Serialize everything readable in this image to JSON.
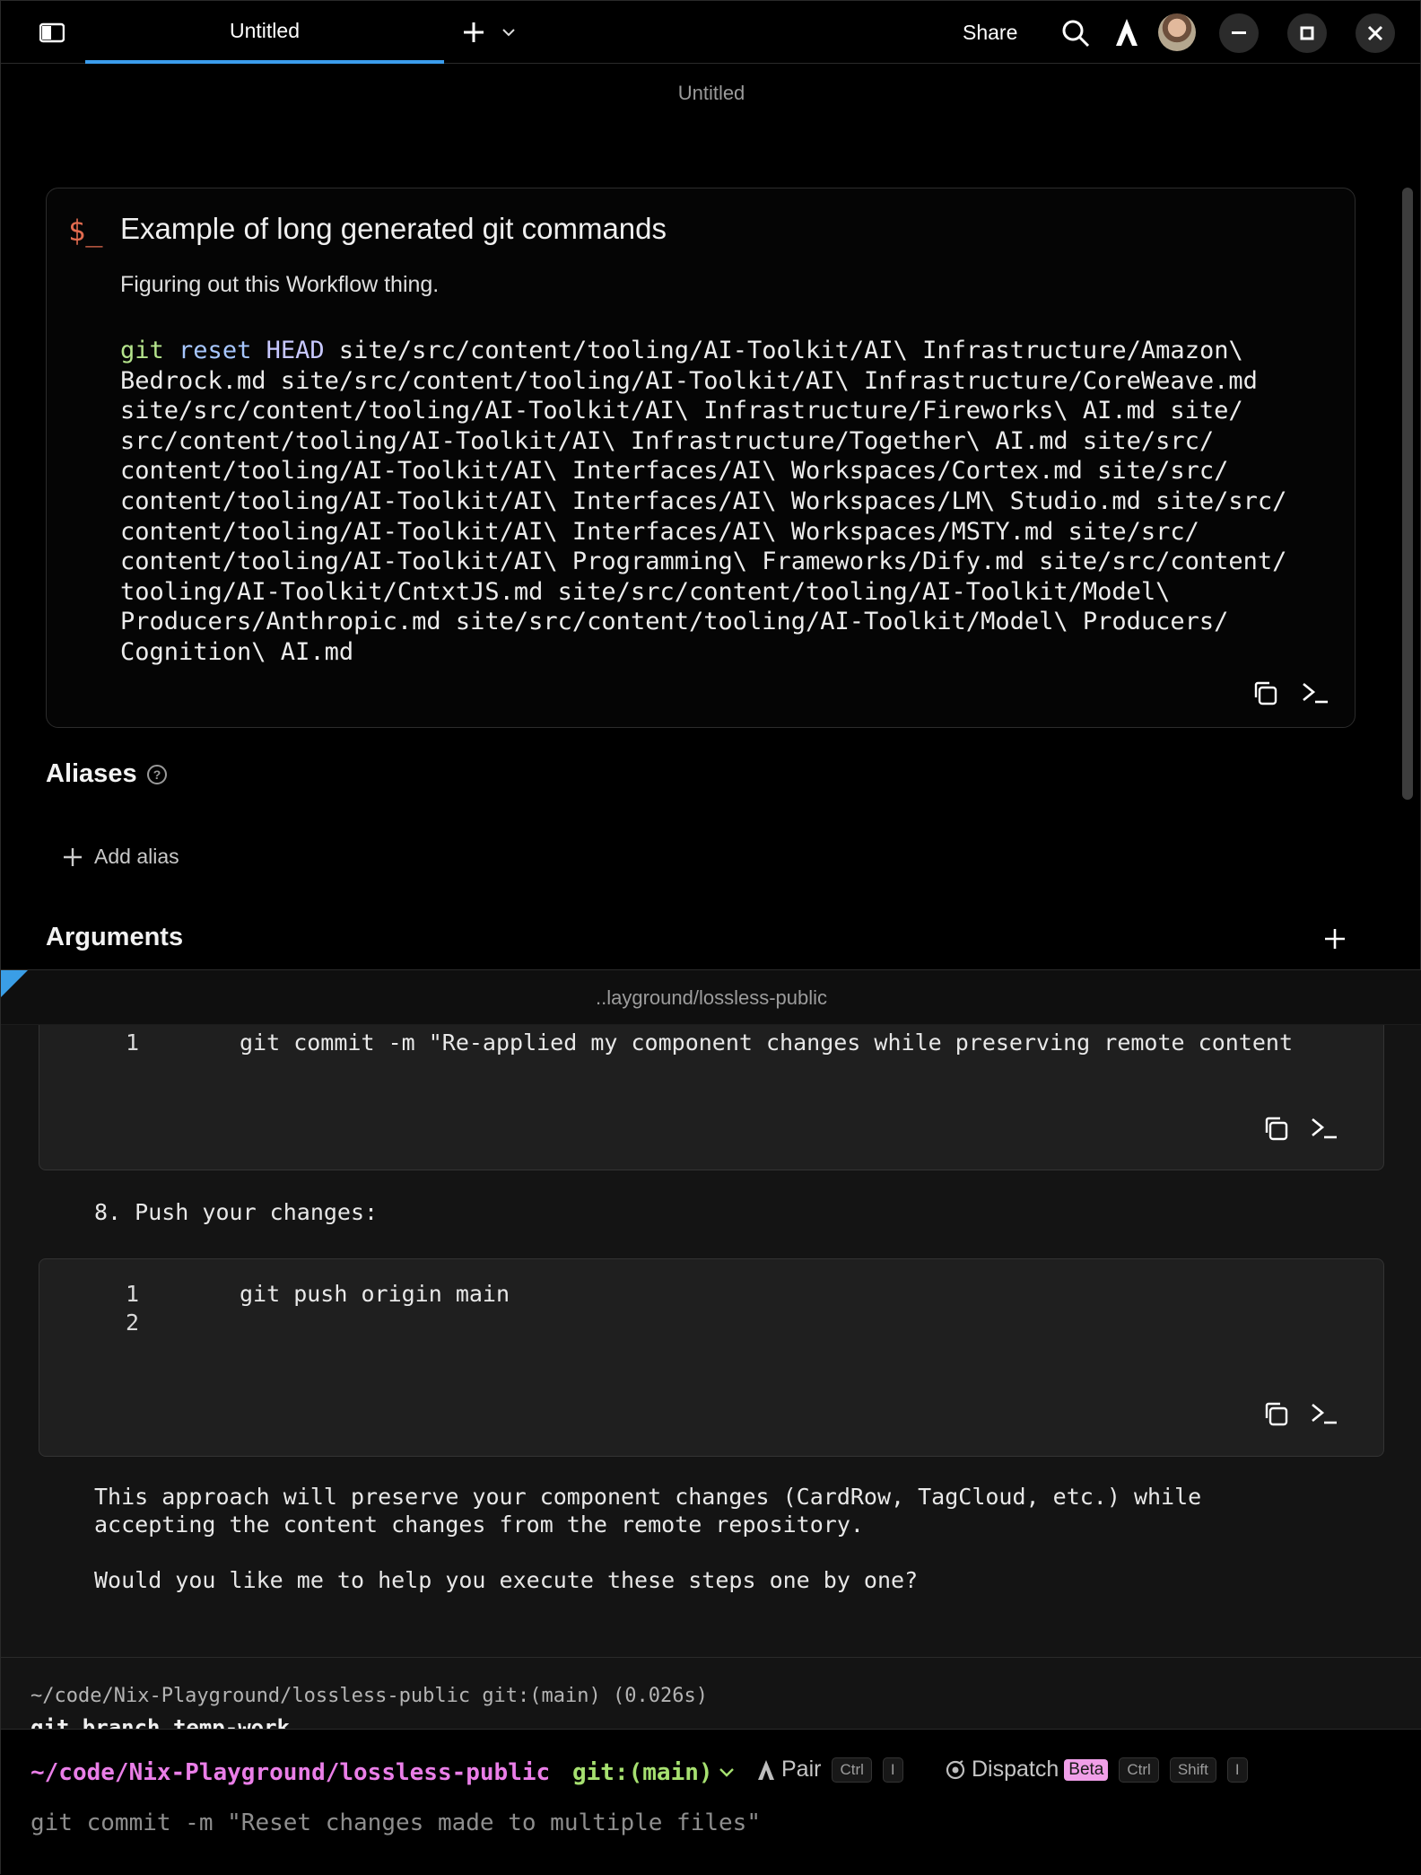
{
  "titlebar": {
    "tab_title": "Untitled",
    "share_label": "Share"
  },
  "editor": {
    "doc_title": "Untitled",
    "workflow": {
      "prompt_symbol": "$_",
      "name": "Example of long generated git commands",
      "description": "Figuring out this Workflow thing.",
      "cmd_git": "git",
      "cmd_reset": "reset",
      "cmd_head": "HEAD",
      "command_lines": [
        " site/src/content/tooling/AI-Toolkit/AI\\ Infrastructure/Amazon\\",
        "Bedrock.md site/src/content/tooling/AI-Toolkit/AI\\ Infrastructure/CoreWeave.md",
        "site/src/content/tooling/AI-Toolkit/AI\\ Infrastructure/Fireworks\\ AI.md site/",
        "src/content/tooling/AI-Toolkit/AI\\ Infrastructure/Together\\ AI.md site/src/",
        "content/tooling/AI-Toolkit/AI\\ Interfaces/AI\\ Workspaces/Cortex.md site/src/",
        "content/tooling/AI-Toolkit/AI\\ Interfaces/AI\\ Workspaces/LM\\ Studio.md site/src/",
        "content/tooling/AI-Toolkit/AI\\ Interfaces/AI\\ Workspaces/MSTY.md site/src/",
        "content/tooling/AI-Toolkit/AI\\ Programming\\ Frameworks/Dify.md site/src/content/",
        "tooling/AI-Toolkit/CntxtJS.md site/src/content/tooling/AI-Toolkit/Model\\",
        "Producers/Anthropic.md site/src/content/tooling/AI-Toolkit/Model\\ Producers/",
        "Cognition\\ AI.md"
      ]
    },
    "aliases_heading": "Aliases",
    "add_alias_label": "Add alias",
    "arguments_heading": "Arguments"
  },
  "pane": {
    "path": "..layground/lossless-public"
  },
  "terminal": {
    "block1": {
      "line_numbers": [
        "1"
      ],
      "code": "git commit -m \"Re-applied my component changes while preserving remote content"
    },
    "step8": "8. Push your changes:",
    "block2": {
      "line_numbers": [
        "1",
        "2"
      ],
      "code": "git push origin main"
    },
    "para1_line1": "This approach will preserve your component changes (CardRow, TagCloud, etc.) while",
    "para1_line2": "accepting the content changes from the remote repository.",
    "para2": "Would you like me to help you execute these steps one by one?"
  },
  "previous_command": {
    "path": "~/code/Nix-Playground/lossless-public git:(main) (0.026s)",
    "command": "git branch temp-work"
  },
  "input": {
    "cwd": "~/code/Nix-Playground/lossless-public",
    "branch": "git:(main)",
    "pair_label": "Pair",
    "pair_keys": [
      "Ctrl",
      "I"
    ],
    "dispatch_label": "Dispatch",
    "beta_badge": "Beta",
    "dispatch_keys": [
      "Ctrl",
      "Shift",
      "I"
    ],
    "input_text": "git commit -m \"Reset changes made to multiple files\""
  },
  "colors": {
    "accent": "#3b9ded",
    "cwd": "#ea7ee8",
    "branch": "#a6e070",
    "prompt_symbol": "#e26b4f"
  }
}
